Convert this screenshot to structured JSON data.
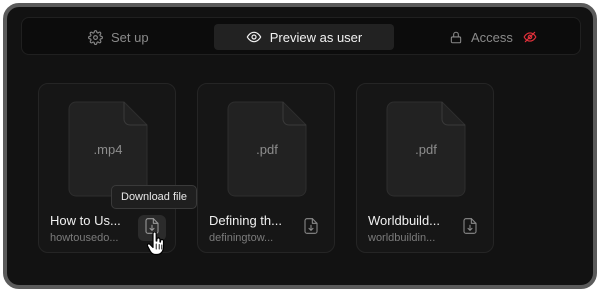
{
  "tabs": {
    "setup": {
      "label": "Set up",
      "icon": "gear-icon"
    },
    "preview": {
      "label": "Preview as user",
      "icon": "eye-icon",
      "active": true
    },
    "access": {
      "label": "Access",
      "icon": "lock-icon",
      "status_icon": "eye-off-icon"
    }
  },
  "files": [
    {
      "ext": ".mp4",
      "name": "How to Us...",
      "sub": "howtousedo...",
      "action_icon": "file-download-icon"
    },
    {
      "ext": ".pdf",
      "name": "Defining th...",
      "sub": "definingtow...",
      "action_icon": "file-download-icon"
    },
    {
      "ext": ".pdf",
      "name": "Worldbuild...",
      "sub": "worldbuildin...",
      "action_icon": "file-download-icon"
    }
  ],
  "tooltip": {
    "text": "Download file"
  },
  "colors": {
    "background": "#121212",
    "frame_border": "#5b5b5b",
    "active_tab": "#222222",
    "hidden_indicator": "#e0303a",
    "text_primary": "#f0f0f0",
    "text_muted": "#7b7b7b"
  }
}
